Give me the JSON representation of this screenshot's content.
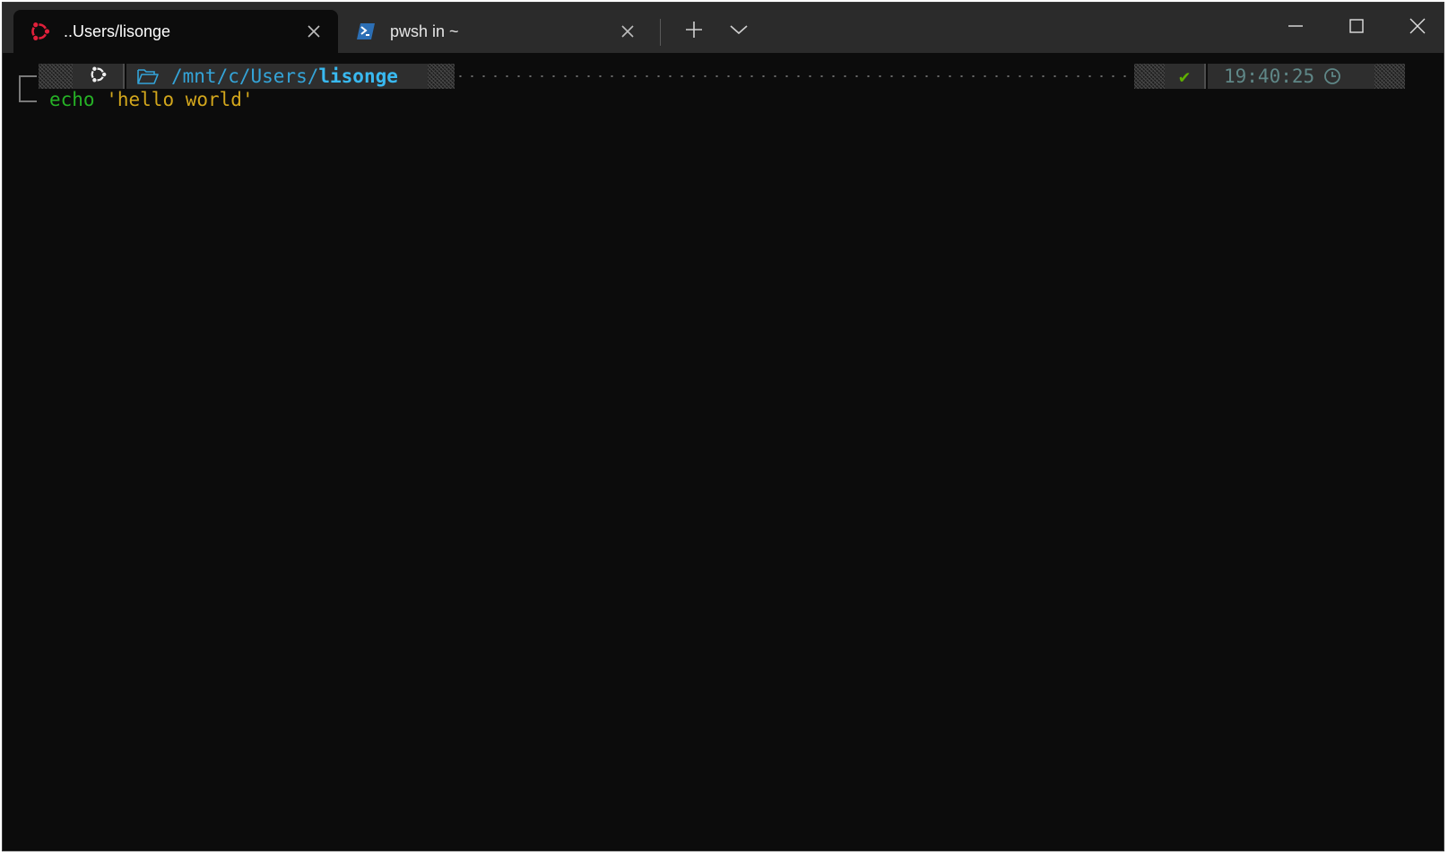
{
  "tabs": [
    {
      "title": "..Users/lisonge",
      "icon": "ubuntu-icon",
      "active": true
    },
    {
      "title": "pwsh in ~",
      "icon": "powershell-icon",
      "active": false
    }
  ],
  "toolbar": {
    "new_tab_icon": "plus-icon",
    "dropdown_icon": "chevron-down-icon"
  },
  "window_controls": [
    "minimize-icon",
    "maximize-icon",
    "close-icon"
  ],
  "prompt": {
    "os_icon": "ubuntu-icon",
    "folder_icon": "folder-open-icon",
    "path_prefix": "/mnt/c/Users/",
    "path_anchor": "lisonge",
    "status_icon": "check-icon",
    "status_symbol": "✔",
    "time": "19:40:25",
    "time_icon": "clock-icon"
  },
  "command": {
    "name": "echo",
    "argument": "'hello world'"
  },
  "colors": {
    "background": "#0c0c0c",
    "titlebar": "#2b2b2b",
    "path": "#34a4d8",
    "command": "#26b226",
    "string": "#d2a61c",
    "status_ok": "#5fb000",
    "time": "#5f8787",
    "ubuntu": "#e2203b"
  }
}
